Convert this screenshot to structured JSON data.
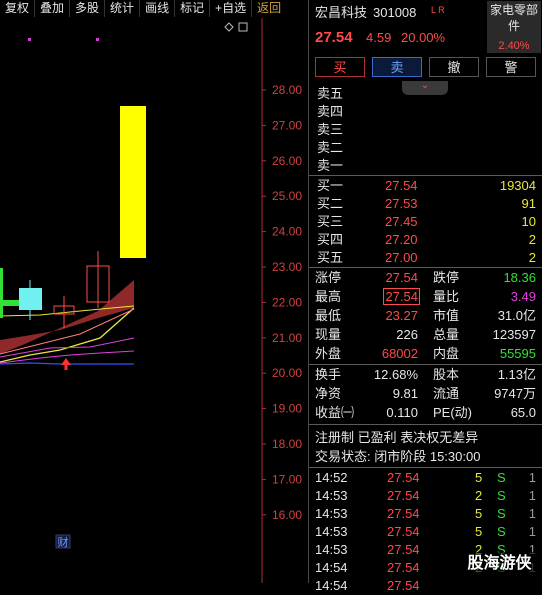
{
  "toolbar": {
    "items": [
      "复权",
      "叠加",
      "多股",
      "统计",
      "画线",
      "标记",
      "+自选"
    ],
    "back": "返回"
  },
  "chart_data": {
    "type": "candlestick",
    "y_axis_labels": [
      "28.00",
      "27.00",
      "26.00",
      "25.00",
      "24.00",
      "23.00",
      "22.00",
      "21.00",
      "20.00",
      "19.00",
      "18.00",
      "17.00",
      "16.00"
    ],
    "bottom_marker": "财"
  },
  "header": {
    "stock_name": "宏昌科技",
    "stock_code": "301008",
    "flags": "L R",
    "price": "27.54",
    "change": "4.59",
    "change_pct": "20.00%",
    "sector": "家电零部件",
    "sector_pct": "2.40%"
  },
  "trade_buttons": {
    "buy": "买",
    "sell": "卖",
    "cancel": "撤",
    "alert": "警"
  },
  "sells": [
    {
      "label": "卖五",
      "price": "",
      "vol": ""
    },
    {
      "label": "卖四",
      "price": "",
      "vol": ""
    },
    {
      "label": "卖三",
      "price": "",
      "vol": ""
    },
    {
      "label": "卖二",
      "price": "",
      "vol": ""
    },
    {
      "label": "卖一",
      "price": "",
      "vol": ""
    }
  ],
  "buys": [
    {
      "label": "买一",
      "price": "27.54",
      "vol": "19304"
    },
    {
      "label": "买二",
      "price": "27.53",
      "vol": "91"
    },
    {
      "label": "买三",
      "price": "27.45",
      "vol": "10"
    },
    {
      "label": "买四",
      "price": "27.20",
      "vol": "2"
    },
    {
      "label": "买五",
      "price": "27.00",
      "vol": "2"
    }
  ],
  "stats": {
    "limit_up_label": "涨停",
    "limit_up": "27.54",
    "limit_down_label": "跌停",
    "limit_down": "18.36",
    "high_label": "最高",
    "high": "27.54",
    "vol_ratio_label": "量比",
    "vol_ratio": "3.49",
    "low_label": "最低",
    "low": "23.27",
    "mkt_rate_label": "市值",
    "mkt_rate": "31.0亿",
    "cur_vol_label": "现量",
    "cur_vol": "226",
    "total_vol_label": "总量",
    "total_vol": "123597",
    "outer_label": "外盘",
    "outer": "68002",
    "inner_label": "内盘",
    "inner": "55595",
    "turnover_label": "换手",
    "turnover": "12.68%",
    "equity_label": "股本",
    "equity": "1.13亿",
    "nav_label": "净资",
    "nav": "9.81",
    "float_label": "流通",
    "float": "9747万",
    "eps_label": "收益㈠",
    "eps": "0.110",
    "pe_label": "PE(动)",
    "pe": "65.0"
  },
  "notes": {
    "line1": "注册制 已盈利 表决权无差异",
    "line2": "交易状态: 闭市阶段 15:30:00"
  },
  "ticks": [
    {
      "time": "14:52",
      "price": "27.54",
      "vol": "5",
      "dir": "S",
      "num": "1"
    },
    {
      "time": "14:53",
      "price": "27.54",
      "vol": "2",
      "dir": "S",
      "num": "1"
    },
    {
      "time": "14:53",
      "price": "27.54",
      "vol": "5",
      "dir": "S",
      "num": "1"
    },
    {
      "time": "14:53",
      "price": "27.54",
      "vol": "5",
      "dir": "S",
      "num": "1"
    },
    {
      "time": "14:53",
      "price": "27.54",
      "vol": "2",
      "dir": "S",
      "num": "1"
    },
    {
      "time": "14:54",
      "price": "27.54",
      "vol": "2",
      "dir": "S",
      "num": "1"
    },
    {
      "time": "14:54",
      "price": "27.54",
      "vol": "",
      "dir": "",
      "num": ""
    }
  ],
  "watermark": "股海游侠",
  "colors": {
    "up": "#ff4a4a",
    "down": "#33e033",
    "accent": "#e8e83a"
  }
}
